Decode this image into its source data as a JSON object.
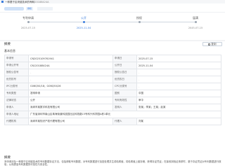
{
  "header": {
    "title": "一种基于区块链技术的专利",
    "patent_no": "CN120188424A"
  },
  "tabs": {
    "status_chip": "授权"
  },
  "timeline": [
    {
      "label": "专利申请",
      "date": "2025-07-15",
      "active": false
    },
    {
      "label": "公开",
      "date": "2025-11-04",
      "active": true
    },
    {
      "label": "授权",
      "date": "",
      "active": false
    },
    {
      "label": "届满",
      "date": "2045-07-15",
      "active": false
    }
  ],
  "summary": {
    "title": "摘要",
    "copy_label": "复制"
  },
  "basic_info": {
    "title": "基本信息",
    "rows": [
      {
        "k1": "申请号",
        "v1": "CN2025109761941",
        "k2": "申请日",
        "v2": "2025-07-15"
      },
      {
        "k1": "申请公开号",
        "v1": "CN120188424A",
        "k2": "公开日",
        "v2": "2025-11-04"
      },
      {
        "k1": "授权公告号",
        "v1": "-",
        "k2": "授权公告日",
        "v2": "-"
      },
      {
        "k1": "优先权号",
        "v1": "-",
        "k2": "优先权日",
        "v2": "-"
      },
      {
        "k1": "IPC分类号",
        "v1": "G06Q50/18；G06Q50/26",
        "k2": "CPC分类号",
        "v2": "-"
      },
      {
        "k1": "专利类型",
        "v1": "发明申请",
        "k2": "国别",
        "v2": "中国"
      },
      {
        "k1": "法律状态",
        "v1": "公开",
        "k2": "专利有效性",
        "v2": "审中"
      },
      {
        "k1": "申请人",
        "v1": "深圳市某数字科技有限公司",
        "k2": "发明人",
        "v2": "张某；李某；王某；赵某"
      },
      {
        "k1": "申请人地址",
        "v1": "广东省深圳市南山区粤海街道科技园社区科苑路15号科兴科学园A栋1单元",
        "k2": "",
        "v2": ""
      },
      {
        "k1": "代理机构",
        "v1": "深圳市某知识产权代理有限公司",
        "k2": "代理人",
        "v2": "刘某"
      }
    ]
  },
  "abstract": {
    "title": "摘要",
    "text": "本申请涉及一种基于区块链技术的专利数据存证方法，包括获取专利数据，对专利数据进行加密处理并生成哈希值，将哈希值上链存储，获得存证凭证；在接收到验证请求时，基于存证凭证对专利数据进行核验，从而提高专利数据的可信性与安全性。"
  },
  "colors": {
    "accent": "#3b7ddd",
    "orange": "#e08a00"
  }
}
